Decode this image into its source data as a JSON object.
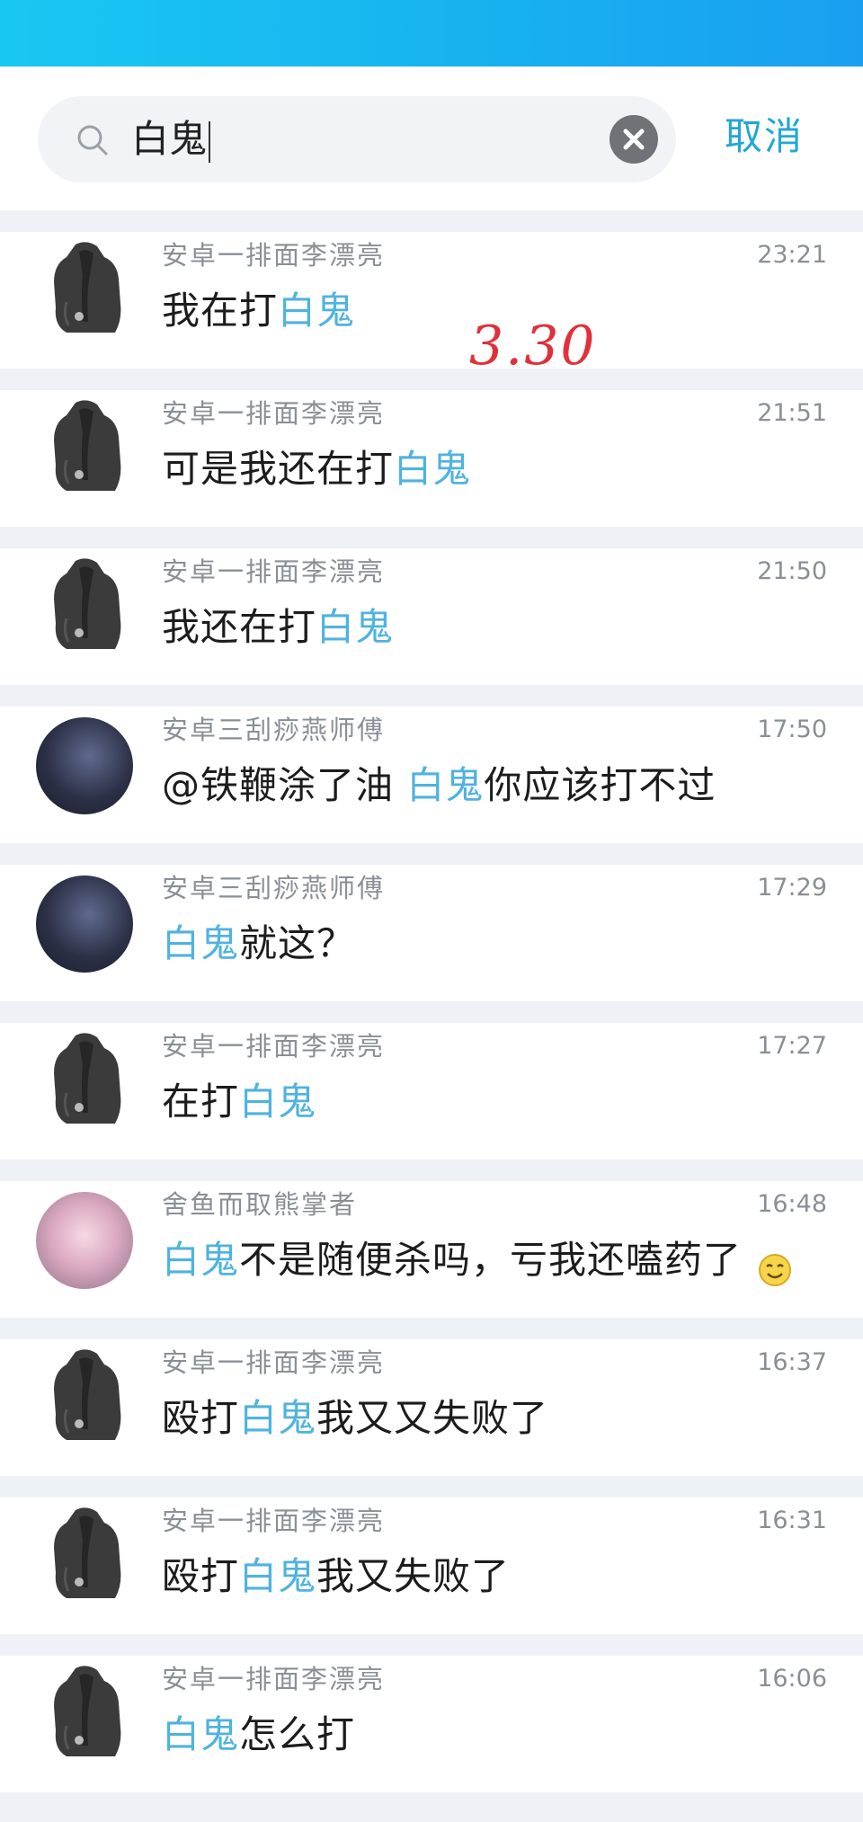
{
  "search": {
    "query": "白鬼",
    "cancel_label": "取消"
  },
  "annotation": "3.30",
  "messages": [
    {
      "sender": "安卓一排面李漂亮",
      "time": "23:21",
      "prefix": "我在打",
      "keyword": "白鬼",
      "suffix": "",
      "avatar": "silhouette"
    },
    {
      "sender": "安卓一排面李漂亮",
      "time": "21:51",
      "prefix": "可是我还在打",
      "keyword": "白鬼",
      "suffix": "",
      "avatar": "silhouette"
    },
    {
      "sender": "安卓一排面李漂亮",
      "time": "21:50",
      "prefix": "我还在打",
      "keyword": "白鬼",
      "suffix": "",
      "avatar": "silhouette"
    },
    {
      "sender": "安卓三刮痧燕师傅",
      "time": "17:50",
      "prefix": "@铁鞭涂了油 ",
      "keyword": "白鬼",
      "suffix": "你应该打不过",
      "avatar": "dark"
    },
    {
      "sender": "安卓三刮痧燕师傅",
      "time": "17:29",
      "prefix": "",
      "keyword": "白鬼",
      "suffix": "就这？",
      "avatar": "dark"
    },
    {
      "sender": "安卓一排面李漂亮",
      "time": "17:27",
      "prefix": "在打",
      "keyword": "白鬼",
      "suffix": "",
      "avatar": "silhouette"
    },
    {
      "sender": "舍鱼而取熊掌者",
      "time": "16:48",
      "prefix": "",
      "keyword": "白鬼",
      "suffix": "不是随便杀吗，亏我还嗑药了",
      "avatar": "pink"
    },
    {
      "sender": "安卓一排面李漂亮",
      "time": "16:37",
      "prefix": "殴打",
      "keyword": "白鬼",
      "suffix": "我又又失败了",
      "avatar": "silhouette"
    },
    {
      "sender": "安卓一排面李漂亮",
      "time": "16:31",
      "prefix": "殴打",
      "keyword": "白鬼",
      "suffix": "我又失败了",
      "avatar": "silhouette"
    },
    {
      "sender": "安卓一排面李漂亮",
      "time": "16:06",
      "prefix": "",
      "keyword": "白鬼",
      "suffix": "怎么打",
      "avatar": "silhouette"
    }
  ]
}
